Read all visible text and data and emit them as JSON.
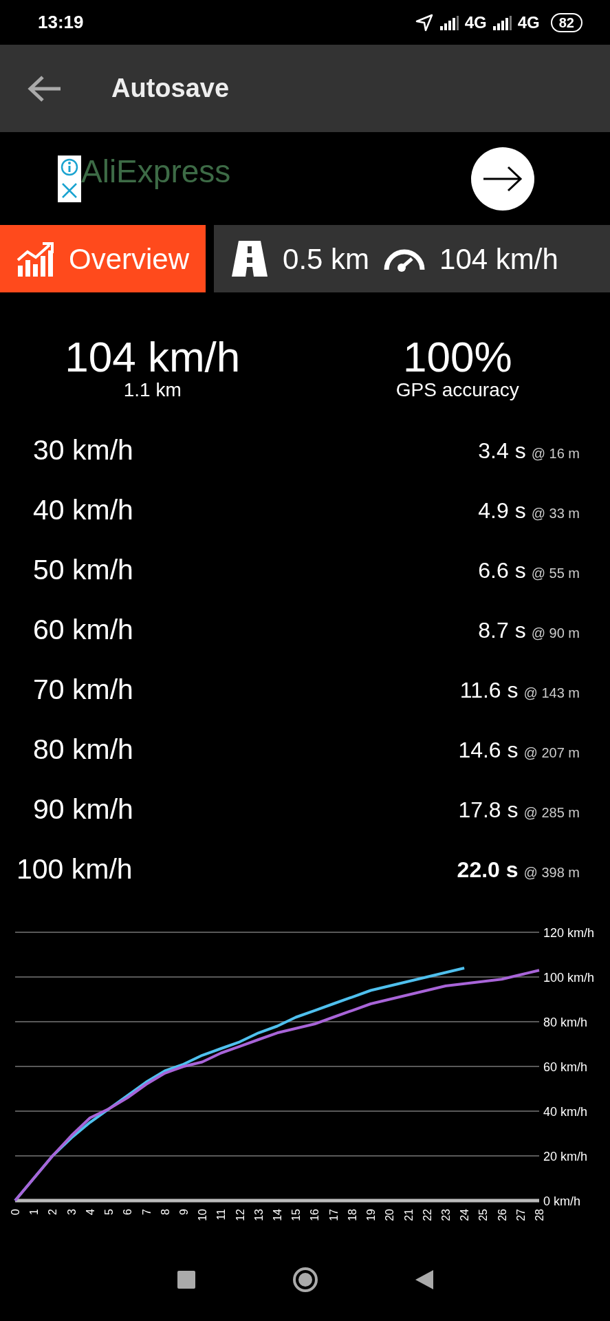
{
  "status_bar": {
    "time": "13:19",
    "network_1": "4G",
    "network_2": "4G",
    "battery": "82"
  },
  "app_bar": {
    "title": "Autosave"
  },
  "ad": {
    "brand": "AliExpress"
  },
  "tabs": [
    {
      "kind": "overview",
      "label": "Overview",
      "selected": true
    },
    {
      "kind": "summary",
      "distance": "0.5 km",
      "speed": "104 km/h",
      "selected": false
    }
  ],
  "stats": [
    {
      "value": "104 km/h",
      "label": "1.1 km"
    },
    {
      "value": "100%",
      "label": "GPS accuracy"
    }
  ],
  "splits": [
    {
      "speed": "30 km/h",
      "time": "3.4 s",
      "distance": "@ 16 m",
      "highlighted": false
    },
    {
      "speed": "40 km/h",
      "time": "4.9 s",
      "distance": "@ 33 m",
      "highlighted": false
    },
    {
      "speed": "50 km/h",
      "time": "6.6 s",
      "distance": "@ 55 m",
      "highlighted": false
    },
    {
      "speed": "60 km/h",
      "time": "8.7 s",
      "distance": "@ 90 m",
      "highlighted": false
    },
    {
      "speed": "70 km/h",
      "time": "11.6 s",
      "distance": "@ 143 m",
      "highlighted": false
    },
    {
      "speed": "80 km/h",
      "time": "14.6 s",
      "distance": "@ 207 m",
      "highlighted": false
    },
    {
      "speed": "90 km/h",
      "time": "17.8 s",
      "distance": "@ 285 m",
      "highlighted": false
    },
    {
      "speed": "100 km/h",
      "time": "22.0 s",
      "distance": "@ 398 m",
      "highlighted": true
    }
  ],
  "chart": {
    "chart_data": {
      "type": "line",
      "x": [
        0,
        1,
        2,
        3,
        4,
        5,
        6,
        7,
        8,
        9,
        10,
        11,
        12,
        13,
        14,
        15,
        16,
        17,
        18,
        19,
        20,
        21,
        22,
        23,
        24,
        25,
        26,
        27,
        28
      ],
      "series": [
        {
          "color": "#4fc0ee",
          "values": [
            0,
            10,
            20,
            28,
            35,
            41,
            47,
            53,
            58,
            61,
            65,
            68,
            71,
            75,
            78,
            82,
            85,
            88,
            91,
            94,
            96,
            98,
            100,
            102,
            104,
            null,
            null,
            null,
            null
          ]
        },
        {
          "color": "#a864d8",
          "values": [
            0,
            10,
            20,
            29,
            37,
            41,
            46,
            52,
            57,
            60,
            62,
            66,
            69,
            72,
            75,
            77,
            79,
            82,
            85,
            88,
            90,
            92,
            94,
            96,
            97,
            98,
            99,
            101,
            103
          ]
        }
      ],
      "grid": true,
      "xlim": [
        0,
        28
      ],
      "ylim": [
        0,
        120
      ],
      "xticks": [
        0,
        1,
        2,
        3,
        4,
        5,
        6,
        7,
        8,
        9,
        10,
        11,
        12,
        13,
        14,
        15,
        16,
        17,
        18,
        19,
        20,
        21,
        22,
        23,
        24,
        25,
        26,
        27,
        28
      ],
      "yticks": [
        {
          "value": 0,
          "label": "0 km/h"
        },
        {
          "value": 20,
          "label": "20 km/h"
        },
        {
          "value": 40,
          "label": "40 km/h"
        },
        {
          "value": 60,
          "label": "60 km/h"
        },
        {
          "value": 80,
          "label": "80 km/h"
        },
        {
          "value": 100,
          "label": "100 km/h"
        },
        {
          "value": 120,
          "label": "120 km/h"
        }
      ]
    }
  }
}
